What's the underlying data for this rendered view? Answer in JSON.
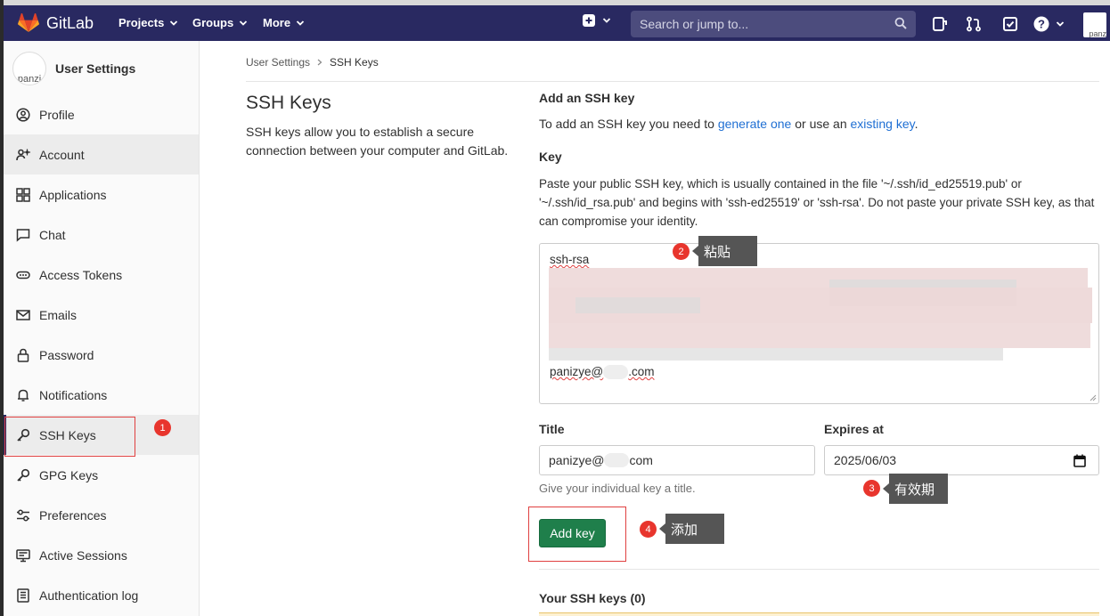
{
  "nav": {
    "brand": "GitLab",
    "menus": [
      "Projects",
      "Groups",
      "More"
    ],
    "search_placeholder": "Search or jump to...",
    "avatar_label": "panz"
  },
  "sidebar": {
    "title": "User Settings",
    "avatar_label": "panzi",
    "items": [
      {
        "label": "Profile",
        "icon": "profile-icon"
      },
      {
        "label": "Account",
        "icon": "account-icon"
      },
      {
        "label": "Applications",
        "icon": "applications-icon"
      },
      {
        "label": "Chat",
        "icon": "chat-icon"
      },
      {
        "label": "Access Tokens",
        "icon": "token-icon"
      },
      {
        "label": "Emails",
        "icon": "email-icon"
      },
      {
        "label": "Password",
        "icon": "lock-icon"
      },
      {
        "label": "Notifications",
        "icon": "bell-icon"
      },
      {
        "label": "SSH Keys",
        "icon": "key-icon"
      },
      {
        "label": "GPG Keys",
        "icon": "key-icon"
      },
      {
        "label": "Preferences",
        "icon": "preferences-icon"
      },
      {
        "label": "Active Sessions",
        "icon": "monitor-icon"
      },
      {
        "label": "Authentication log",
        "icon": "log-icon"
      }
    ]
  },
  "breadcrumb": [
    "User Settings",
    "SSH Keys"
  ],
  "page": {
    "title": "SSH Keys",
    "lead": "SSH keys allow you to establish a secure connection between your computer and GitLab."
  },
  "form": {
    "heading": "Add an SSH key",
    "intro_prefix": "To add an SSH key you need to ",
    "intro_link1": "generate one",
    "intro_middle": " or use an ",
    "intro_link2": "existing key",
    "intro_suffix": ".",
    "key_label": "Key",
    "key_help": "Paste your public SSH key, which is usually contained in the file '~/.ssh/id_ed25519.pub' or '~/.ssh/id_rsa.pub' and begins with 'ssh-ed25519' or 'ssh-rsa'. Do not paste your private SSH key, as that can compromise your identity.",
    "key_first_line": "ssh-rsa",
    "key_last_line_prefix": "panizye@",
    "key_last_line_suffix": ".com",
    "title_label": "Title",
    "title_value_prefix": "panizye@",
    "title_value_suffix": "com",
    "expires_label": "Expires at",
    "expires_value": "2025/06/03",
    "title_help": "Give your individual key a title.",
    "submit_label": "Add key",
    "your_keys": "Your SSH keys (0)"
  },
  "annotations": [
    {
      "num": "1"
    },
    {
      "num": "2",
      "text": "粘贴"
    },
    {
      "num": "3",
      "text": "有效期"
    },
    {
      "num": "4",
      "text": "添加"
    }
  ]
}
